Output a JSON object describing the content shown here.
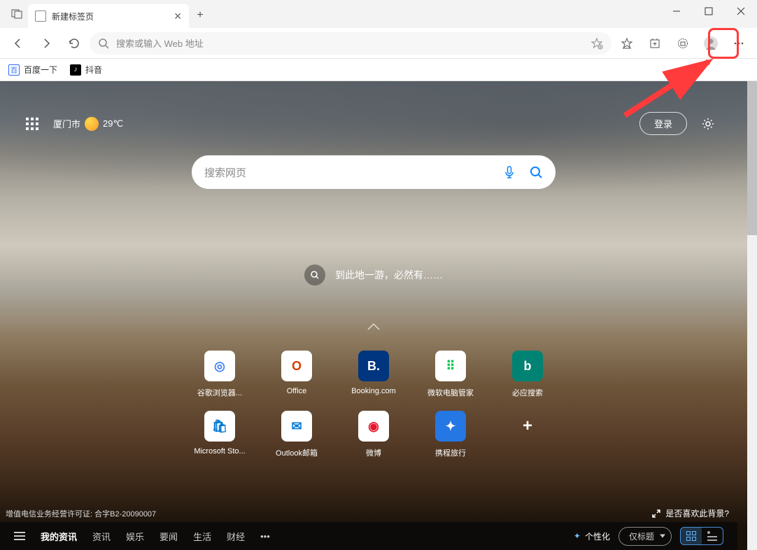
{
  "tab": {
    "title": "新建标签页"
  },
  "address": {
    "placeholder": "搜索或输入 Web 地址"
  },
  "bookmarks": [
    {
      "label": "百度一下",
      "bg": "#2e68ff",
      "icon": "百"
    },
    {
      "label": "抖音",
      "bg": "#000",
      "icon": "♪"
    }
  ],
  "weather": {
    "city": "厦门市",
    "temp": "29℃"
  },
  "top": {
    "login": "登录"
  },
  "search": {
    "placeholder": "搜索网页"
  },
  "tagline": "到此地一游，必然有……",
  "quicklinks_row1": [
    {
      "label": "谷歌浏览器...",
      "tile_bg": "#fff",
      "glyph": "◎",
      "color": "#4285f4"
    },
    {
      "label": "Office",
      "tile_bg": "#fff",
      "glyph": "O",
      "color": "#d83b01"
    },
    {
      "label": "Booking.com",
      "tile_bg": "#003580",
      "glyph": "B.",
      "color": "#fff"
    },
    {
      "label": "微软电脑管家",
      "tile_bg": "#fff",
      "glyph": "⠿",
      "color": "#00c853"
    },
    {
      "label": "必应搜索",
      "tile_bg": "#008373",
      "glyph": "b",
      "color": "#fff"
    }
  ],
  "quicklinks_row2": [
    {
      "label": "Microsoft Sto...",
      "tile_bg": "#fff",
      "glyph": "🛍",
      "color": "#0078d4"
    },
    {
      "label": "Outlook邮箱",
      "tile_bg": "#fff",
      "glyph": "✉",
      "color": "#0078d4"
    },
    {
      "label": "微博",
      "tile_bg": "#fff",
      "glyph": "◉",
      "color": "#e6162d"
    },
    {
      "label": "携程旅行",
      "tile_bg": "#2577e3",
      "glyph": "✦",
      "color": "#fff"
    }
  ],
  "license": "增值电信业务经营许可证: 合字B2-20090007",
  "bg_feedback": "是否喜欢此背景?",
  "feed": {
    "tabs": [
      "我的资讯",
      "资讯",
      "娱乐",
      "要闻",
      "生活",
      "财经"
    ],
    "personalize": "个性化",
    "layout_sel": "仅标题"
  }
}
